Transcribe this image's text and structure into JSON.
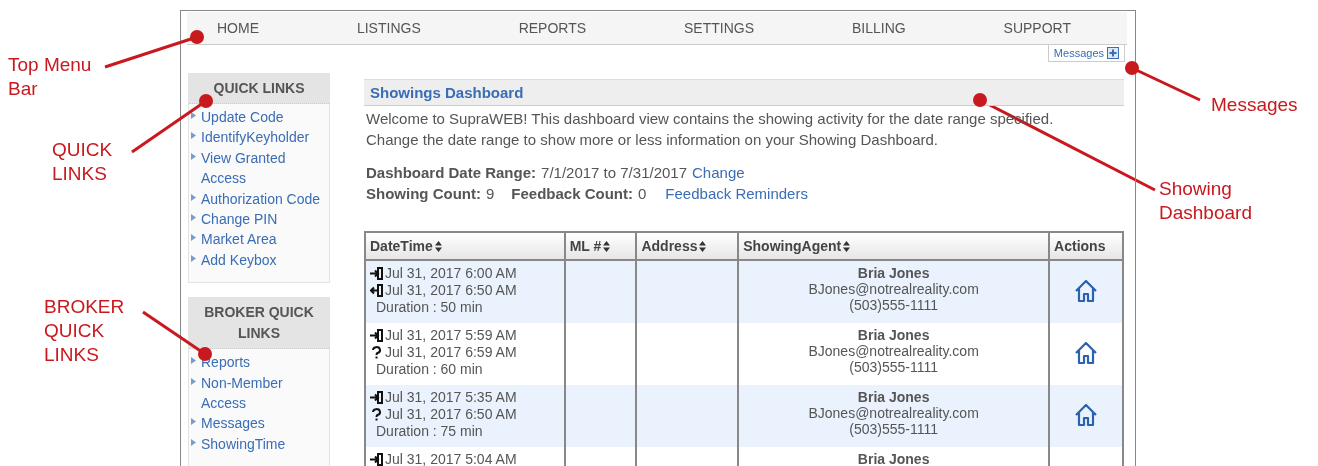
{
  "nav": {
    "items": [
      {
        "label": "HOME"
      },
      {
        "label": "LISTINGS"
      },
      {
        "label": "REPORTS"
      },
      {
        "label": "SETTINGS"
      },
      {
        "label": "BILLING"
      },
      {
        "label": "SUPPORT"
      }
    ]
  },
  "messages_button": {
    "label": "Messages"
  },
  "sidebar": {
    "sections": [
      {
        "title": "QUICK LINKS",
        "items": [
          "Update Code",
          "IdentifyKeyholder",
          "View Granted Access",
          "Authorization Code",
          "Change PIN",
          "Market Area",
          "Add Keybox"
        ]
      },
      {
        "title": "BROKER QUICK LINKS",
        "items": [
          "Reports",
          "Non-Member Access",
          "Messages",
          "ShowingTime"
        ]
      }
    ]
  },
  "dashboard": {
    "title": "Showings Dashboard",
    "intro": "Welcome to SupraWEB! This dashboard view contains the showing activity for the date range specified. Change the date range to show more or less information on your Showing Dashboard.",
    "date_range": {
      "label": "Dashboard Date Range:",
      "value": "7/1/2017 to 7/31/2017",
      "link": "Change"
    },
    "showing_count": {
      "label": "Showing Count:",
      "value": "9"
    },
    "feedback_count": {
      "label": "Feedback Count:",
      "value": "0"
    },
    "feedback_link": "Feedback Reminders",
    "table": {
      "columns": [
        {
          "label": "DateTime",
          "sortable": true
        },
        {
          "label": "ML #",
          "sortable": true
        },
        {
          "label": "Address",
          "sortable": true
        },
        {
          "label": "ShowingAgent",
          "sortable": true
        },
        {
          "label": "Actions",
          "sortable": false
        }
      ],
      "rows": [
        {
          "times": [
            {
              "kind": "in",
              "text": "Jul 31, 2017 6:00 AM"
            },
            {
              "kind": "out",
              "text": "Jul 31, 2017 6:50 AM"
            }
          ],
          "duration": "Duration : 50 min",
          "agent": {
            "name": "Bria Jones",
            "email": "BJones@notrealreality.com",
            "phone": "(503)555-1111"
          }
        },
        {
          "times": [
            {
              "kind": "in",
              "text": "Jul 31, 2017 5:59 AM"
            },
            {
              "kind": "unknown",
              "text": "Jul 31, 2017 6:59 AM"
            }
          ],
          "duration": "Duration : 60 min",
          "agent": {
            "name": "Bria Jones",
            "email": "BJones@notrealreality.com",
            "phone": "(503)555-1111"
          }
        },
        {
          "times": [
            {
              "kind": "in",
              "text": "Jul 31, 2017 5:35 AM"
            },
            {
              "kind": "unknown",
              "text": "Jul 31, 2017 6:50 AM"
            }
          ],
          "duration": "Duration : 75 min",
          "agent": {
            "name": "Bria Jones",
            "email": "BJones@notrealreality.com",
            "phone": "(503)555-1111"
          }
        },
        {
          "times": [
            {
              "kind": "in",
              "text": "Jul 31, 2017 5:04 AM"
            }
          ],
          "agent": {
            "name": "Bria Jones"
          }
        }
      ]
    }
  },
  "annotations": [
    {
      "label": "Top Menu Bar"
    },
    {
      "label": "QUICK LINKS"
    },
    {
      "label": "BROKER QUICK LINKS"
    },
    {
      "label": "Messages"
    },
    {
      "label": "Showing Dashboard"
    }
  ]
}
